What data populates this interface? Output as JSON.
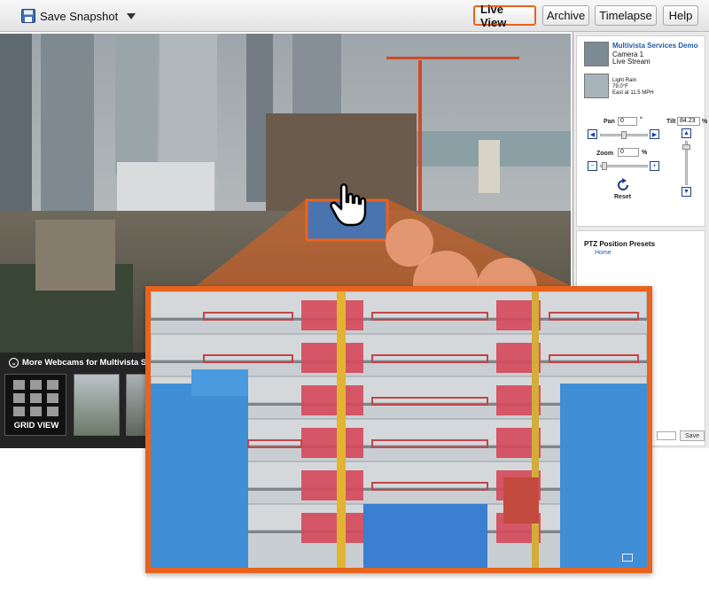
{
  "toolbar": {
    "save_snapshot_label": "Save Snapshot",
    "buttons": {
      "live_view": "Live View",
      "archive": "Archive",
      "timelapse": "Timelapse",
      "help": "Help"
    }
  },
  "panel": {
    "site_name": "Multivista Services Demo",
    "camera_name": "Camera 1",
    "stream_label": "Live Stream",
    "weather": {
      "condition": "Light Rain",
      "temperature": "79.0°F",
      "wind": "East at 11.5 MPH"
    },
    "controls": {
      "pan_label": "Pan",
      "pan_value": "0",
      "pan_unit": "°",
      "tilt_label": "Tilt",
      "tilt_value": "84.23",
      "tilt_unit": "%",
      "zoom_label": "Zoom",
      "zoom_value": "0",
      "zoom_unit": "%",
      "reset_label": "Reset"
    },
    "presets": {
      "title": "PTZ Position Presets",
      "items": [
        "Home"
      ],
      "save_label": "Save"
    }
  },
  "webcams": {
    "title": "More Webcams for Multivista S",
    "grid_label": "GRID VIEW"
  },
  "colors": {
    "accent": "#e8631d",
    "link": "#1f5aa8"
  }
}
